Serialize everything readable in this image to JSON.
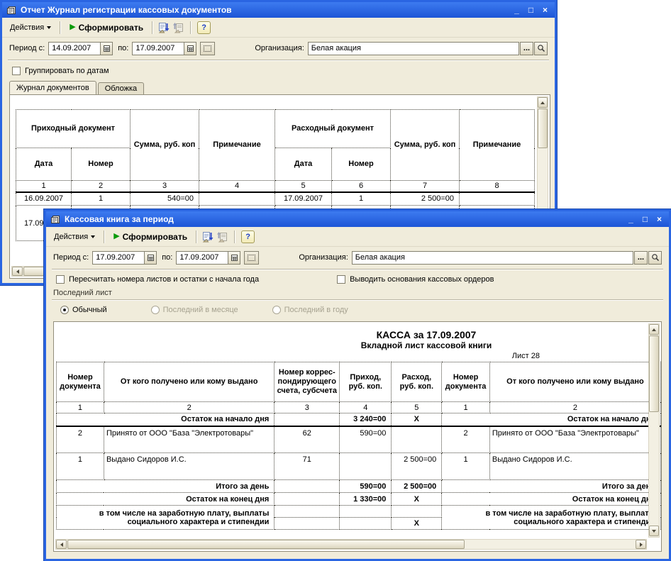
{
  "chrome": {
    "minimize": "_",
    "maximize": "□",
    "close": "×",
    "help": "?",
    "ellipsis": "..."
  },
  "journal_window": {
    "title": "Отчет Журнал регистрации кассовых документов",
    "toolbar": {
      "actions": "Действия",
      "generate": "Сформировать"
    },
    "filters": {
      "period_from_label": "Период с:",
      "period_from": "14.09.2007",
      "period_to_label": "по:",
      "period_to": "17.09.2007",
      "org_label": "Организация:",
      "org": "Белая акация"
    },
    "group_by_dates": "Группировать по датам",
    "tabs": [
      "Журнал документов",
      "Обложка"
    ],
    "table": {
      "income_group": "Приходный документ",
      "expense_group": "Расходный документ",
      "date": "Дата",
      "number": "Номер",
      "sum": "Сумма, руб. коп",
      "note": "Примечание",
      "nums": [
        "1",
        "2",
        "3",
        "4",
        "5",
        "6",
        "7",
        "8"
      ],
      "row1": [
        "16.09.2007",
        "1",
        "540=00",
        "",
        "17.09.2007",
        "1",
        "2 500=00",
        ""
      ],
      "row2": [
        "17.09.2007",
        "",
        "",
        "",
        "",
        "",
        "",
        ""
      ]
    }
  },
  "cashbook_window": {
    "title": "Кассовая книга за период",
    "toolbar": {
      "actions": "Действия",
      "generate": "Сформировать"
    },
    "filters": {
      "period_from_label": "Период с:",
      "period_from": "17.09.2007",
      "period_to_label": "по:",
      "period_to": "17.09.2007",
      "org_label": "Организация:",
      "org": "Белая акация"
    },
    "checkbox1": "Пересчитать номера листов и остатки с начала года",
    "checkbox2": "Выводить основания кассовых ордеров",
    "last_sheet": {
      "label": "Последний лист",
      "opt1": "Обычный",
      "opt2": "Последний в месяце",
      "opt3": "Последний в году"
    },
    "report": {
      "title": "КАССА за 17.09.2007",
      "subtitle": "Вкладной лист кассовой книги",
      "sheet": "Лист 28",
      "h_doc": "Номер документа",
      "h_from": "От кого получено или кому выдано",
      "h_corr": "Номер коррес-пондирующего счета, субсчета",
      "h_income": "Приход, руб. коп.",
      "h_expense": "Расход, руб. коп.",
      "nums": [
        "1",
        "2",
        "3",
        "4",
        "5",
        "1",
        "2"
      ],
      "opening": {
        "label": "Остаток на начало дня",
        "income": "3 240=00",
        "expense": "X"
      },
      "r1": {
        "doc": "2",
        "from": "Принято от ООО \"База \"Электротовары\"",
        "corr": "62",
        "income": "590=00",
        "expense": ""
      },
      "r2": {
        "doc": "1",
        "from": "Выдано Сидоров И.С.",
        "corr": "71",
        "income": "",
        "expense": "2 500=00"
      },
      "total": {
        "label": "Итого за день",
        "income": "590=00",
        "expense": "2 500=00"
      },
      "closing": {
        "label": "Остаток на конец  дня",
        "income": "1 330=00",
        "expense": "X"
      },
      "social": {
        "line1": "в том числе на заработную плату, выплаты",
        "line2": "социального характера и стипендии",
        "expense": "X"
      }
    }
  }
}
